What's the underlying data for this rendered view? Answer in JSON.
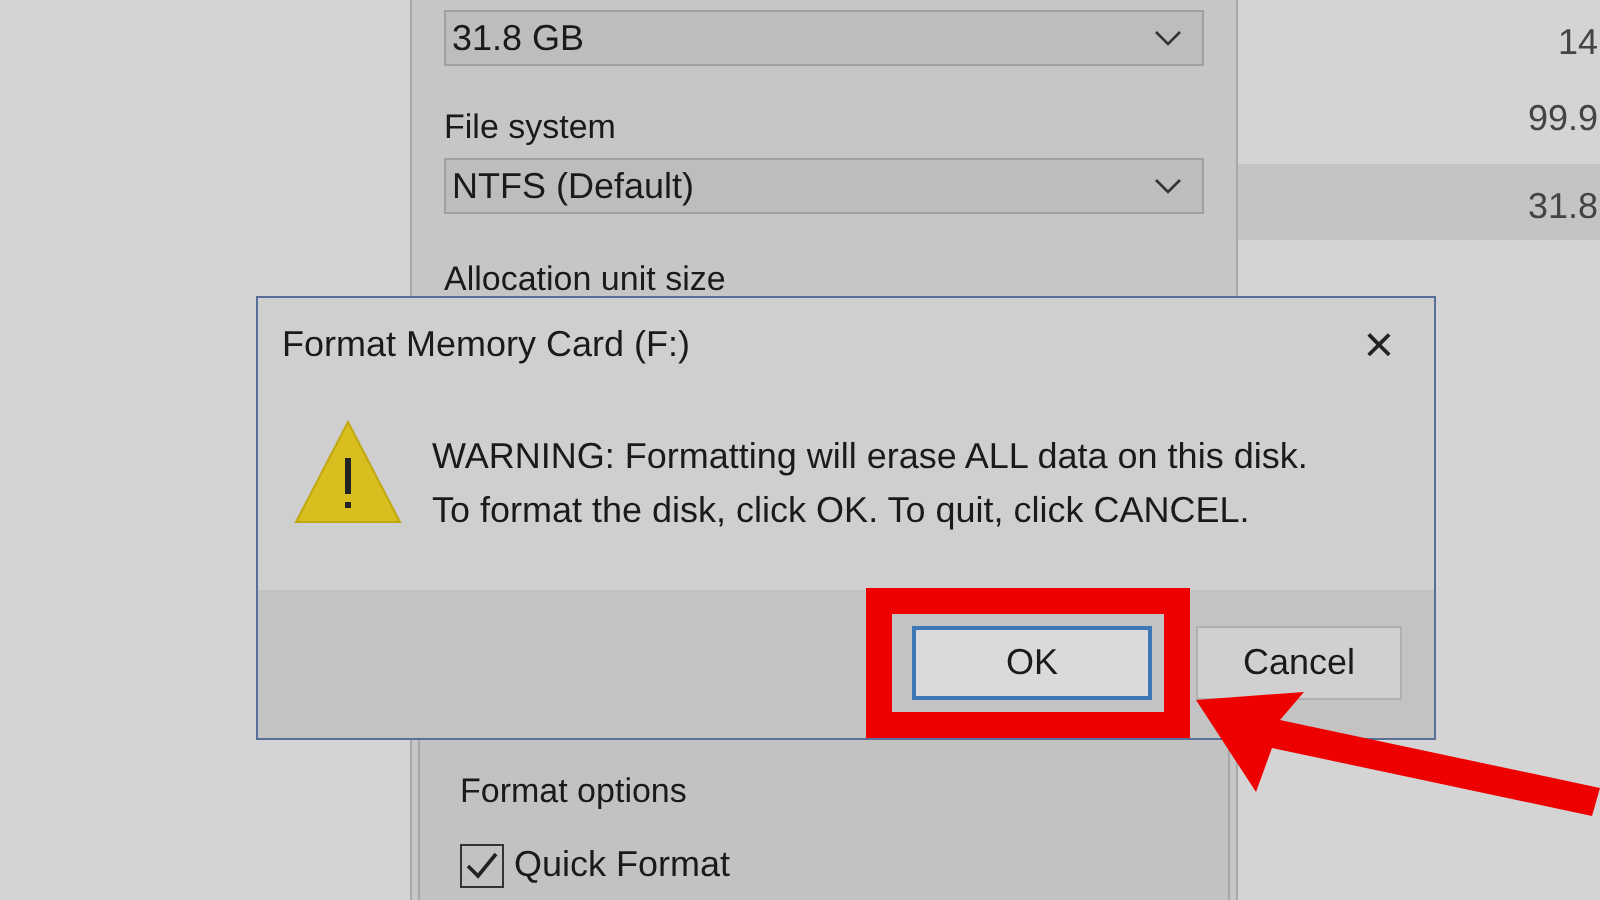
{
  "background_list": {
    "rows": [
      {
        "value": "14",
        "selected": false
      },
      {
        "value": "99.9",
        "selected": false
      },
      {
        "value": "31.8",
        "selected": true
      }
    ]
  },
  "format_window": {
    "capacity": {
      "value": "31.8 GB"
    },
    "file_system": {
      "label": "File system",
      "value": "NTFS (Default)"
    },
    "allocation_unit_size": {
      "label": "Allocation unit size"
    },
    "format_options": {
      "label": "Format options",
      "quick_format": {
        "label": "Quick Format",
        "checked": true
      }
    }
  },
  "dialog": {
    "title": "Format Memory Card (F:)",
    "close": "×",
    "message_lines": [
      "WARNING: Formatting will erase ALL data on this disk.",
      "To format the disk, click OK. To quit, click CANCEL."
    ],
    "buttons": [
      {
        "label": "OK"
      },
      {
        "label": "Cancel"
      }
    ]
  }
}
